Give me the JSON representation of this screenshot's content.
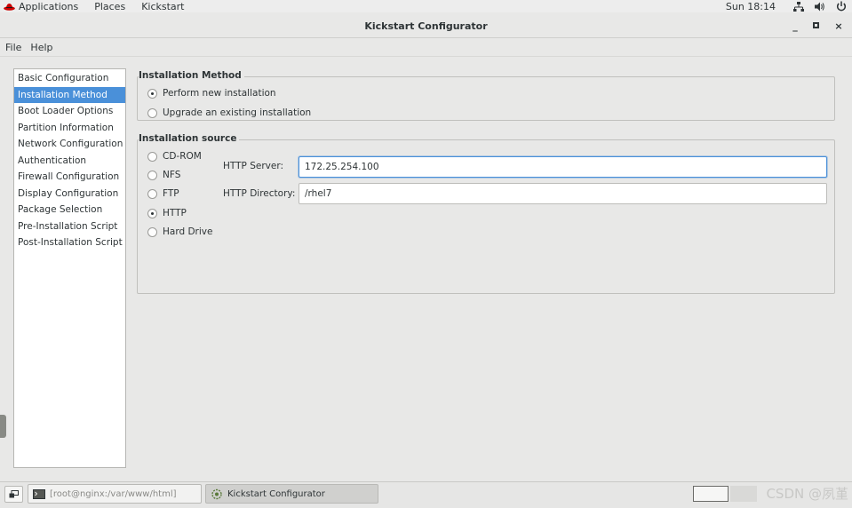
{
  "top_panel": {
    "applications": "Applications",
    "places": "Places",
    "app_name": "Kickstart",
    "clock": "Sun 18:14"
  },
  "window": {
    "title": "Kickstart Configurator",
    "minimize": "_",
    "maximize": "▫",
    "close": "×"
  },
  "menubar": {
    "items": [
      "File",
      "Help"
    ]
  },
  "sidebar": {
    "items": [
      {
        "label": "Basic Configuration"
      },
      {
        "label": "Installation Method"
      },
      {
        "label": "Boot Loader Options"
      },
      {
        "label": "Partition Information"
      },
      {
        "label": "Network Configuration"
      },
      {
        "label": "Authentication"
      },
      {
        "label": "Firewall Configuration"
      },
      {
        "label": "Display Configuration"
      },
      {
        "label": "Package Selection"
      },
      {
        "label": "Pre-Installation Script"
      },
      {
        "label": "Post-Installation Script"
      }
    ],
    "selected": "Installation Method"
  },
  "installation_method": {
    "title": "Installation Method",
    "options": [
      {
        "label": "Perform new installation",
        "checked": true
      },
      {
        "label": "Upgrade an existing installation",
        "checked": false
      }
    ]
  },
  "installation_source": {
    "title": "Installation source",
    "options": [
      {
        "label": "CD-ROM",
        "checked": false
      },
      {
        "label": "NFS",
        "checked": false
      },
      {
        "label": "FTP",
        "checked": false
      },
      {
        "label": "HTTP",
        "checked": true
      },
      {
        "label": "Hard Drive",
        "checked": false
      }
    ],
    "http_server_label": "HTTP Server:",
    "http_server_value": "172.25.254.100",
    "http_directory_label": "HTTP Directory:",
    "http_directory_value": "/rhel7"
  },
  "taskbar": {
    "terminal_task": "[root@nginx:/var/www/html]",
    "kickstart_task": "Kickstart Configurator",
    "watermark": "CSDN @夙堇"
  },
  "colors": {
    "selection": "#4a90d9",
    "window_bg": "#e8e8e7",
    "redhat_red": "#cc0000"
  }
}
